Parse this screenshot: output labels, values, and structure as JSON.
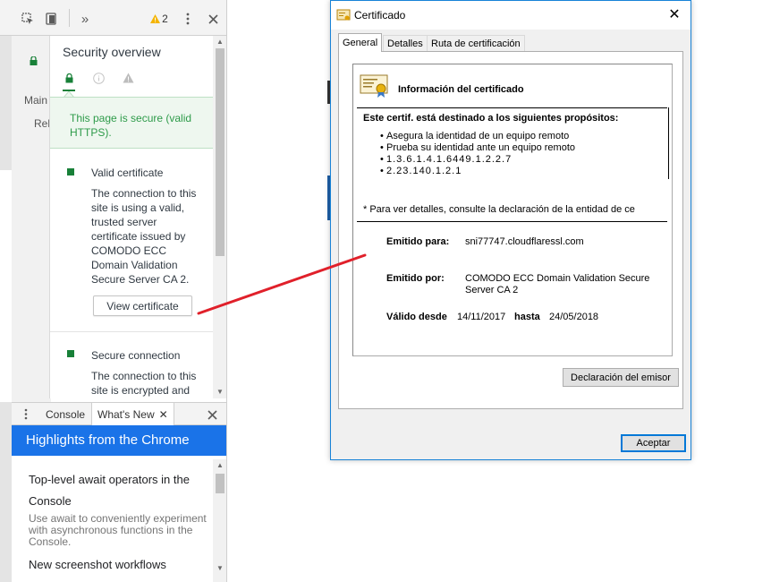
{
  "devtools": {
    "toolbar": {
      "overflow_label": "»",
      "warning_count": "2"
    },
    "background": {
      "main_label": "Main",
      "reload_label": "Rel"
    },
    "security": {
      "title": "Security overview",
      "secure_message": "This page is secure (valid HTTPS).",
      "cards": [
        {
          "title": "Valid certificate",
          "description": "The connection to this site is using a valid, trusted server certificate issued by COMODO ECC Domain Validation Secure Server CA 2.",
          "button_label": "View certificate"
        },
        {
          "title": "Secure connection",
          "description": "The connection to this site is encrypted and"
        }
      ]
    },
    "drawer": {
      "tabs": [
        "Console",
        "What's New"
      ],
      "highlights_title": "Highlights from the Chrome",
      "items": [
        {
          "title": "Top-level await operators in the Console",
          "description": "Use await to conveniently experiment with asynchronous functions in the Console."
        },
        {
          "title": "New screenshot workflows"
        }
      ]
    }
  },
  "certificate": {
    "window_title": "Certificado",
    "tabs": [
      "General",
      "Detalles",
      "Ruta de certificación"
    ],
    "info_title": "Información del certificado",
    "purposes_heading": "Este certif. está destinado a los siguientes propósitos:",
    "purposes": [
      "Asegura la identidad de un equipo remoto",
      "Prueba su identidad ante un equipo remoto",
      "1.3.6.1.4.1.6449.1.2.2.7",
      "2.23.140.1.2.1"
    ],
    "details_note": "* Para ver detalles, consulte la declaración de la entidad de ce",
    "issued_to_label": "Emitido para:",
    "issued_to_value": "sni77747.cloudflaressl.com",
    "issued_by_label": "Emitido por:",
    "issued_by_value": "COMODO ECC Domain Validation Secure Server CA 2",
    "valid_from_label": "Válido desde",
    "valid_from_value": "14/11/2017",
    "valid_to_label": "hasta",
    "valid_to_value": "24/05/2018",
    "issuer_statement_button": "Declaración del emisor",
    "accept_button": "Aceptar"
  },
  "colors": {
    "secure_green": "#188038",
    "chrome_blue": "#1a73e8",
    "annotation_red": "#e0202a",
    "windows_accent": "#0078d7"
  }
}
